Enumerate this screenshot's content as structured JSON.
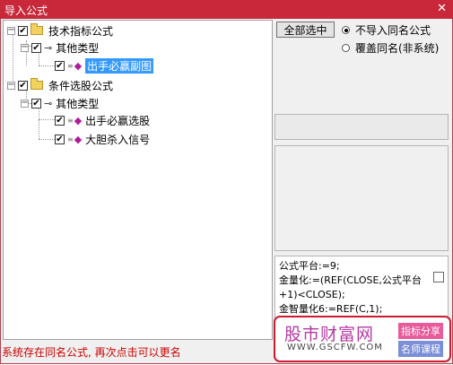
{
  "window": {
    "title": "导入公式",
    "close_glyph": "✕"
  },
  "tree": {
    "root1": {
      "label": "技术指标公式",
      "child": {
        "label": "其他类型",
        "items": [
          "出手必赢副图"
        ]
      }
    },
    "root2": {
      "label": "条件选股公式",
      "child": {
        "label": "其他类型",
        "items": [
          "出手必赢选股",
          "大胆杀入信号"
        ]
      }
    }
  },
  "toolbar": {
    "select_all_label": "全部选中"
  },
  "options": {
    "no_import_label": "不导入同名公式",
    "overwrite_label": "覆盖同名(非系统)",
    "selected": "no_import"
  },
  "code_preview": {
    "lines": [
      "公式平台:=9;",
      "金量化:=(REF(CLOSE,公式平台",
      "+1)<CLOSE);",
      "金智量化6:=REF(C,1);"
    ]
  },
  "status": {
    "message": "系统存在同名公式, 再次点击可以更名"
  },
  "brand": {
    "name": "股市财富网",
    "url": "WWW.GSCFW.COM",
    "tag1": "指标分享",
    "tag2": "名师课程",
    "border_color": "#cc1a2e"
  },
  "colors": {
    "titlebar": "#c8283a",
    "selection": "#3399ff",
    "status_text": "#cc0000"
  }
}
